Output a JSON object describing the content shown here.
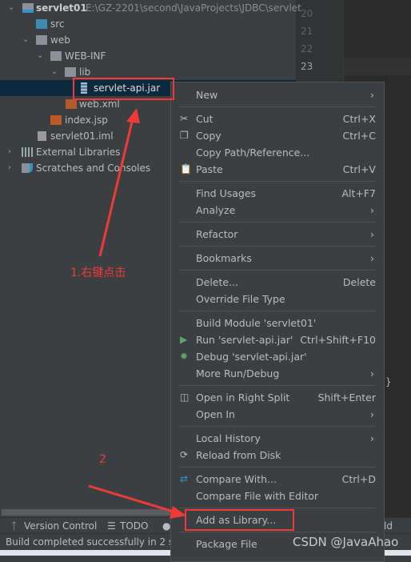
{
  "project_tree": {
    "root": {
      "name": "servlet01",
      "path": "E:\\GZ-2201\\second\\JavaProjects\\JDBC\\servlet"
    },
    "items": [
      {
        "label": "src",
        "icon": "folder-source-icon"
      },
      {
        "label": "web",
        "icon": "web-folder-icon"
      },
      {
        "label": "WEB-INF",
        "icon": "folder-icon"
      },
      {
        "label": "lib",
        "icon": "folder-icon"
      },
      {
        "label": "servlet-api.jar",
        "icon": "jar-icon",
        "selected": true
      },
      {
        "label": "web.xml",
        "icon": "xml-file-icon"
      },
      {
        "label": "index.jsp",
        "icon": "jsp-file-icon"
      },
      {
        "label": "servlet01.iml",
        "icon": "iml-file-icon"
      },
      {
        "label": "External Libraries",
        "icon": "libraries-icon"
      },
      {
        "label": "Scratches and Consoles",
        "icon": "scratches-icon"
      }
    ]
  },
  "editor": {
    "line_numbers": [
      "20",
      "21",
      "22",
      "23"
    ],
    "brace": "}"
  },
  "context_menu": {
    "groups": [
      [
        {
          "label": "New",
          "submenu": true
        }
      ],
      [
        {
          "label": "Cut",
          "shortcut": "Ctrl+X",
          "icon": "scissors-icon"
        },
        {
          "label": "Copy",
          "shortcut": "Ctrl+C",
          "icon": "copy-icon"
        },
        {
          "label": "Copy Path/Reference..."
        },
        {
          "label": "Paste",
          "shortcut": "Ctrl+V",
          "icon": "clipboard-icon"
        }
      ],
      [
        {
          "label": "Find Usages",
          "shortcut": "Alt+F7"
        },
        {
          "label": "Analyze",
          "submenu": true
        }
      ],
      [
        {
          "label": "Refactor",
          "submenu": true
        }
      ],
      [
        {
          "label": "Bookmarks",
          "submenu": true
        }
      ],
      [
        {
          "label": "Delete...",
          "shortcut": "Delete"
        },
        {
          "label": "Override File Type"
        }
      ],
      [
        {
          "label": "Build Module 'servlet01'"
        },
        {
          "label": "Run 'servlet-api.jar'",
          "shortcut": "Ctrl+Shift+F10",
          "icon": "run-icon"
        },
        {
          "label": "Debug 'servlet-api.jar'",
          "icon": "debug-icon"
        },
        {
          "label": "More Run/Debug",
          "submenu": true
        }
      ],
      [
        {
          "label": "Open in Right Split",
          "shortcut": "Shift+Enter",
          "icon": "split-icon"
        },
        {
          "label": "Open In",
          "submenu": true
        }
      ],
      [
        {
          "label": "Local History",
          "submenu": true
        },
        {
          "label": "Reload from Disk",
          "icon": "reload-icon"
        }
      ],
      [
        {
          "label": "Compare With...",
          "shortcut": "Ctrl+D",
          "icon": "compare-icon"
        },
        {
          "label": "Compare File with Editor"
        }
      ],
      [
        {
          "label": "Add as Library...",
          "highlighted_annotation": true
        }
      ],
      [
        {
          "label": "Package File"
        }
      ]
    ]
  },
  "toolbar": {
    "version_control": "Version Control",
    "todo": "TODO",
    "build_partial": "ld"
  },
  "status": {
    "text": "Build completed successfully in 2 se"
  },
  "annotations": {
    "step1": "1.右键点击",
    "step2": "2",
    "color": "#f03a3a"
  },
  "watermark": "CSDN @JavaAhao"
}
